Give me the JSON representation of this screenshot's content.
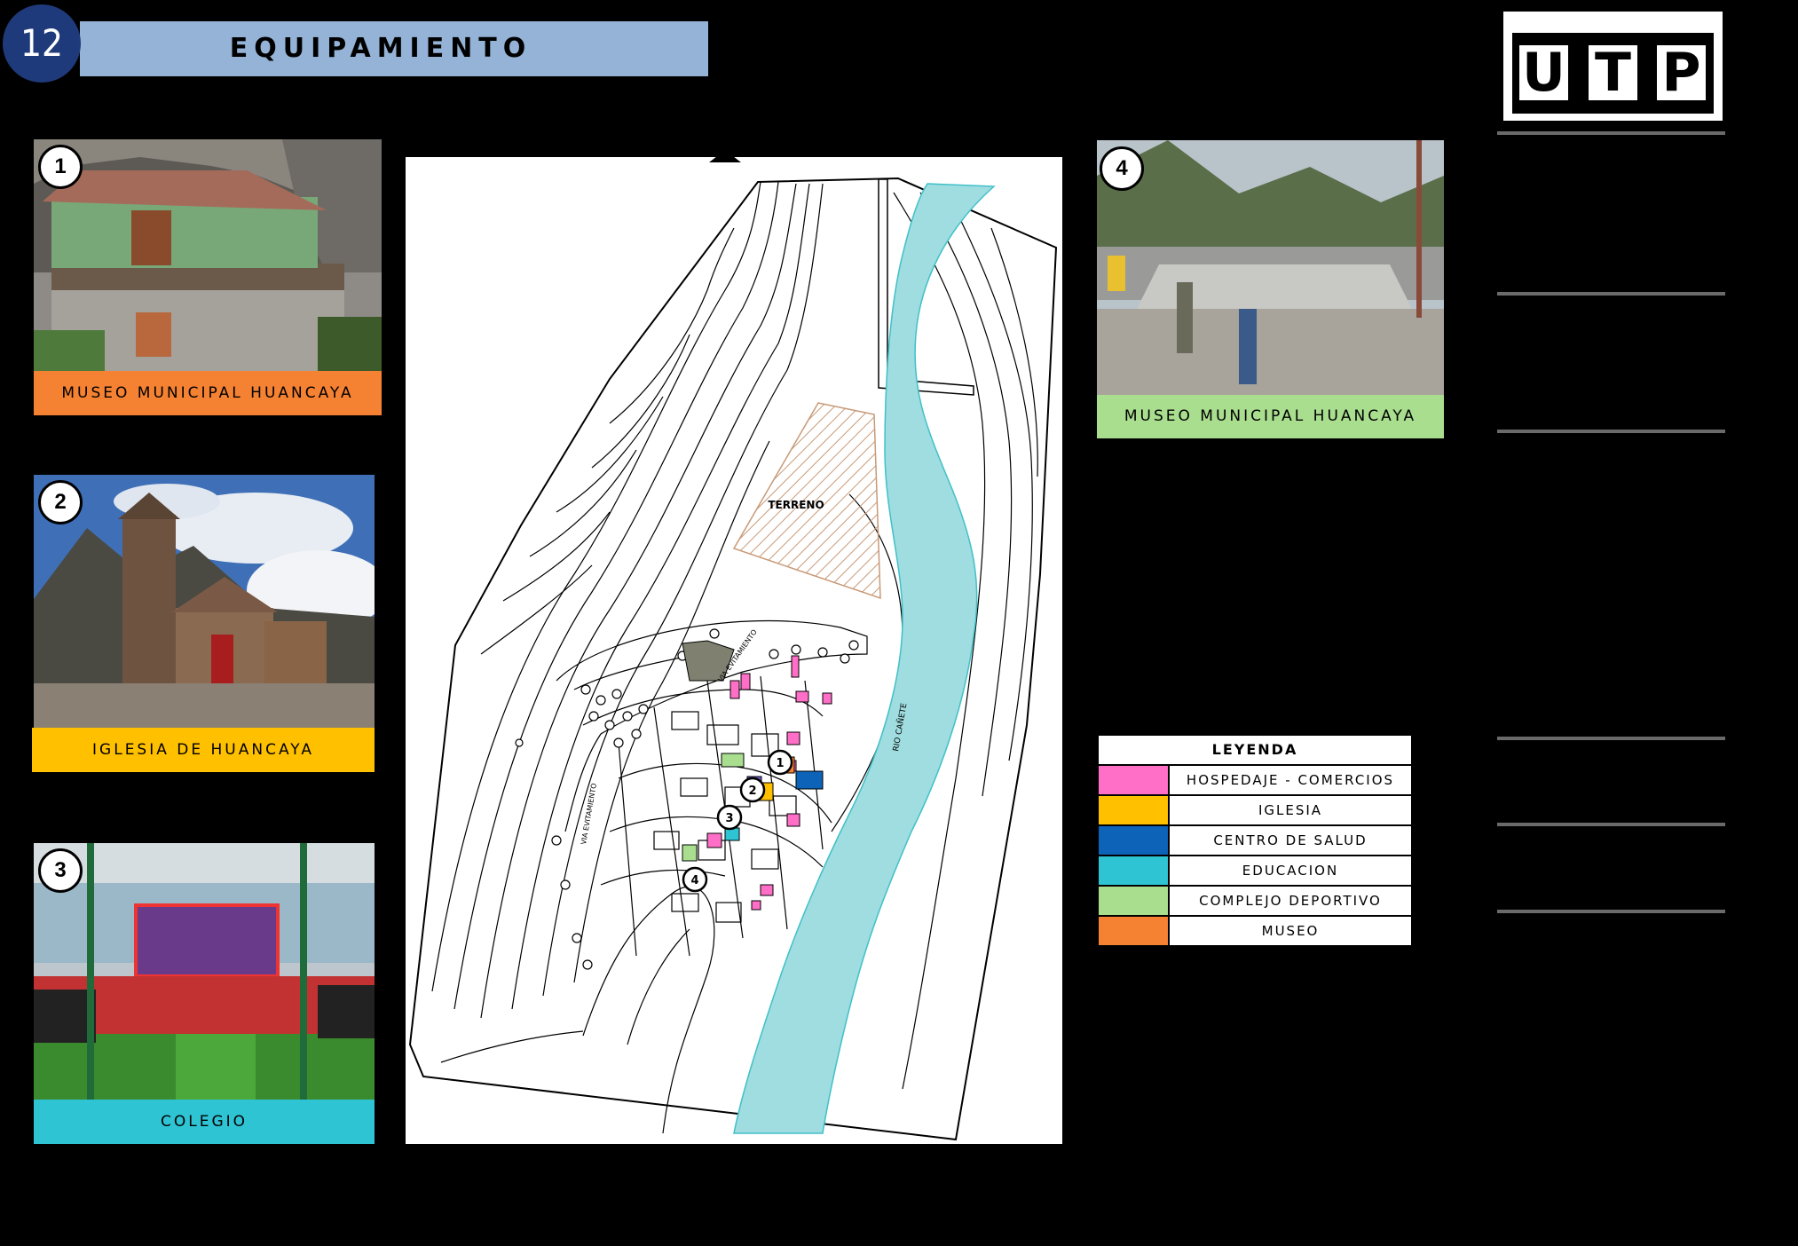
{
  "header": {
    "sheet_number": "12",
    "title": "EQUIPAMIENTO"
  },
  "logo": {
    "text": "UTP",
    "letters": [
      "U",
      "T",
      "P"
    ]
  },
  "photos": [
    {
      "number": "1",
      "caption": "MUSEO MUNICIPAL HUANCAYA",
      "caption_color": "#f58233"
    },
    {
      "number": "2",
      "caption": "IGLESIA DE HUANCAYA",
      "caption_color": "#ffc000"
    },
    {
      "number": "3",
      "caption": "COLEGIO",
      "caption_color": "#2fc4d4"
    },
    {
      "number": "4",
      "caption": "MUSEO MUNICIPAL HUANCAYA",
      "caption_color": "#a9de8f"
    }
  ],
  "map": {
    "terrain_label": "TERRENO",
    "river_label": "RIO CAÑETE",
    "road_label_1": "VIA EVITAMIENTO",
    "road_label_2": "VIA EVITAMIENTO",
    "markers": [
      "1",
      "2",
      "3",
      "4"
    ],
    "colors": {
      "river": "#9fdde0",
      "terrain_hatch": "#c89a78",
      "park": "#808070"
    }
  },
  "legend": {
    "title": "LEYENDA",
    "items": [
      {
        "label": "HOSPEDAJE - COMERCIOS",
        "color": "#ff6ec7"
      },
      {
        "label": "IGLESIA",
        "color": "#ffc000"
      },
      {
        "label": "CENTRO DE SALUD",
        "color": "#0d63b8"
      },
      {
        "label": "EDUCACION",
        "color": "#2fc4d4"
      },
      {
        "label": "COMPLEJO DEPORTIVO",
        "color": "#a9de8f"
      },
      {
        "label": "MUSEO",
        "color": "#f58233"
      }
    ]
  }
}
